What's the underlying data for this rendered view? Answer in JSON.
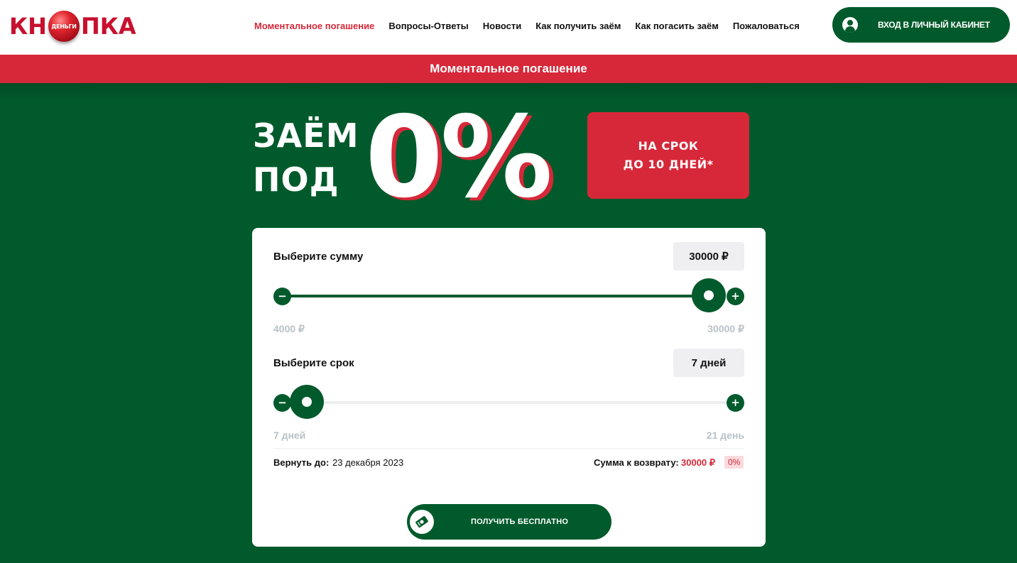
{
  "header": {
    "logo": {
      "left": "КН",
      "ball": "ДЕНЬГИ",
      "right": "ПКА"
    },
    "nav": [
      {
        "label": "Моментальное погашение",
        "active": true
      },
      {
        "label": "Вопросы-Ответы",
        "active": false
      },
      {
        "label": "Новости",
        "active": false
      },
      {
        "label": "Как получить заём",
        "active": false
      },
      {
        "label": "Как погасить заём",
        "active": false
      },
      {
        "label": "Пожаловаться",
        "active": false
      }
    ],
    "login_label": "ВХОД В ЛИЧНЫЙ КАБИНЕТ",
    "login_icon": "user-circle-icon"
  },
  "banner": {
    "text": "Моментальное погашение"
  },
  "hero": {
    "line1": "ЗАЁМ",
    "line2": "ПОД",
    "rate": "0%",
    "term_line1": "НА СРОК",
    "term_line2": "ДО 10 ДНЕЙ*"
  },
  "calculator": {
    "amount": {
      "label": "Выберите сумму",
      "value": "30000 ₽",
      "min_label": "4000 ₽",
      "max_label": "30000 ₽",
      "min": 4000,
      "max": 30000,
      "current": 30000
    },
    "term": {
      "label": "Выберите срок",
      "value": "7 дней",
      "min_label": "7 дней",
      "max_label": "21 день",
      "min": 7,
      "max": 21,
      "current": 7
    },
    "return_label": "Вернуть до:",
    "return_date": "23 декабря 2023",
    "repay_label": "Сумма к возврату:",
    "repay_value": "30000 ₽",
    "repay_percent": "0%",
    "cta_label": "ПОЛУЧИТЬ БЕСПЛАТНО",
    "cta_icon": "money-icon"
  },
  "colors": {
    "brand_green": "#005a2b",
    "brand_red": "#d62839",
    "track_inactive": "#eceef0"
  }
}
